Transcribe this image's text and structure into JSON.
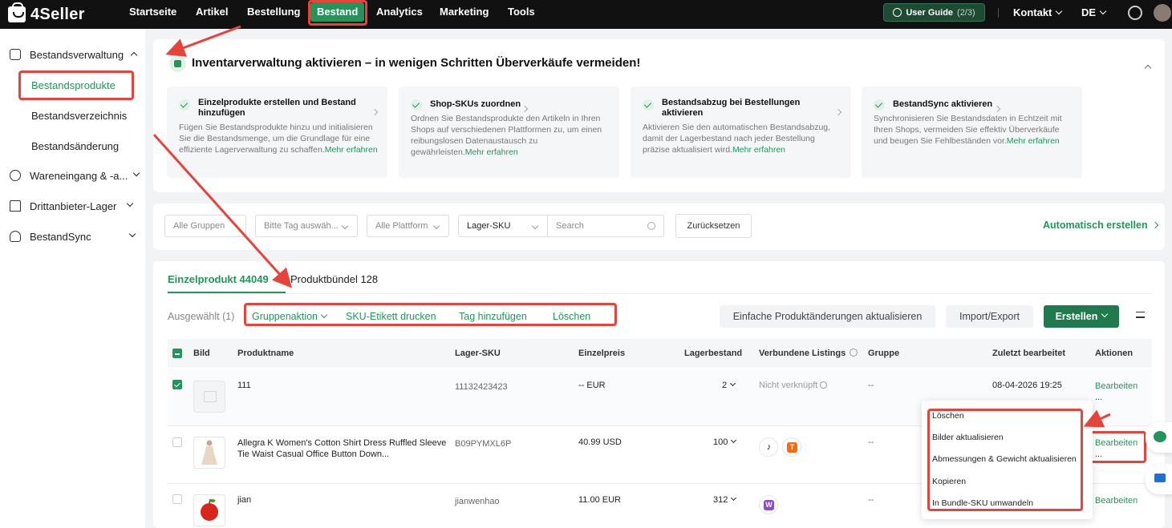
{
  "app": {
    "name": "4Seller"
  },
  "nav": {
    "items": [
      "Startseite",
      "Artikel",
      "Bestellung",
      "Bestand",
      "Analytics",
      "Marketing",
      "Tools"
    ],
    "active": "Bestand",
    "guide_label": "User Guide",
    "guide_progress": "(2/3)",
    "contact": "Kontakt",
    "language": "DE"
  },
  "sidebar": {
    "groups": [
      {
        "label": "Bestandsverwaltung",
        "icon": "inventory-icon"
      },
      {
        "label": "Wareneingang & -a...",
        "icon": "warehouse-in-icon"
      },
      {
        "label": "Drittanbieter-Lager",
        "icon": "third-party-warehouse-icon"
      },
      {
        "label": "BestandSync",
        "icon": "cloud-sync-icon"
      }
    ],
    "sub_items": [
      "Bestandsprodukte",
      "Bestandsverzeichnis",
      "Bestandsänderung"
    ],
    "active_sub": "Bestandsprodukte"
  },
  "banner": {
    "title": "Inventarverwaltung aktivieren – in wenigen Schritten Überverkäufe vermeiden!",
    "cards": [
      {
        "title": "Einzelprodukte erstellen und Bestand hinzufügen",
        "desc": "Fügen Sie Bestandsprodukte hinzu und initialisieren Sie die Bestandsmenge, um die Grundlage für eine effiziente Lagerverwaltung zu schaffen.",
        "more": "Mehr erfahren"
      },
      {
        "title": "Shop-SKUs zuordnen",
        "desc": "Ordnen Sie Bestandsprodukte den Artikeln in Ihren Shops auf verschiedenen Plattformen zu, um einen reibungslosen Datenaustausch zu gewährleisten.",
        "more": "Mehr erfahren"
      },
      {
        "title": "Bestandsabzug bei Bestellungen aktivieren",
        "desc": "Aktivieren Sie den automatischen Bestandsabzug, damit der Lagerbestand nach jeder Bestellung präzise aktualisiert wird.",
        "more": "Mehr erfahren"
      },
      {
        "title": "BestandSync aktivieren",
        "desc": "Synchronisieren Sie Bestandsdaten in Echtzeit mit Ihren Shops, vermeiden Sie effektiv Überverkäufe und beugen Sie Fehlbeständen vor.",
        "more": "Mehr erfahren"
      }
    ]
  },
  "filters": {
    "group": "Alle Gruppen",
    "tag": "Bitte Tag auswäh...",
    "platform": "Alle Plattform",
    "field": "Lager-SKU",
    "search_placeholder": "Search",
    "reset": "Zurücksetzen",
    "auto_create": "Automatisch erstellen"
  },
  "tabs": [
    {
      "label": "Einzelprodukt 44049"
    },
    {
      "label": "Produktbündel 128"
    }
  ],
  "toolbar": {
    "selected": "Ausgewählt (1)",
    "bulk": [
      "Gruppenaktion",
      "SKU-Etikett drucken",
      "Tag hinzufügen",
      "Löschen"
    ],
    "update": "Einfache Produktänderungen aktualisieren",
    "import_export": "Import/Export",
    "create": "Erstellen"
  },
  "columns": [
    "Bild",
    "Produktname",
    "Lager-SKU",
    "Einzelpreis",
    "Lagerbestand",
    "Verbundene Listings",
    "Gruppe",
    "Zuletzt bearbeitet",
    "Aktionen"
  ],
  "rows": [
    {
      "name": "111",
      "name2": "",
      "sku": "11132423423",
      "price": "-- EUR",
      "stock": "2",
      "linked": "Nicht verknüpft",
      "group": "--",
      "edited": "08-04-2026 19:25",
      "action": "Bearbeiten",
      "more": "...",
      "checked": true
    },
    {
      "name": "Allegra K Women's Cotton Shirt Dress Ruffled Sleeve",
      "name2": "Tie Waist Casual Office Button Down...",
      "sku": "B09PYMXL6P",
      "price": "40.99 USD",
      "stock": "100",
      "linked": "",
      "group": "--",
      "edited": "",
      "action": "Bearbeiten",
      "more": "...",
      "checked": false
    },
    {
      "name": "jian",
      "name2": "",
      "sku": "jianwenhao",
      "price": "11.00 EUR",
      "stock": "312",
      "linked": "",
      "group": "--",
      "edited": "",
      "action": "Bearbeiten",
      "more": "",
      "checked": false
    }
  ],
  "menu": [
    "Löschen",
    "Bilder aktualisieren",
    "Abmessungen & Gewicht aktualisieren",
    "Kopieren",
    "In Bundle-SKU umwandeln"
  ],
  "colors": {
    "accent": "#23955b",
    "highlight": "#e8433a",
    "topbar": "#111111"
  }
}
